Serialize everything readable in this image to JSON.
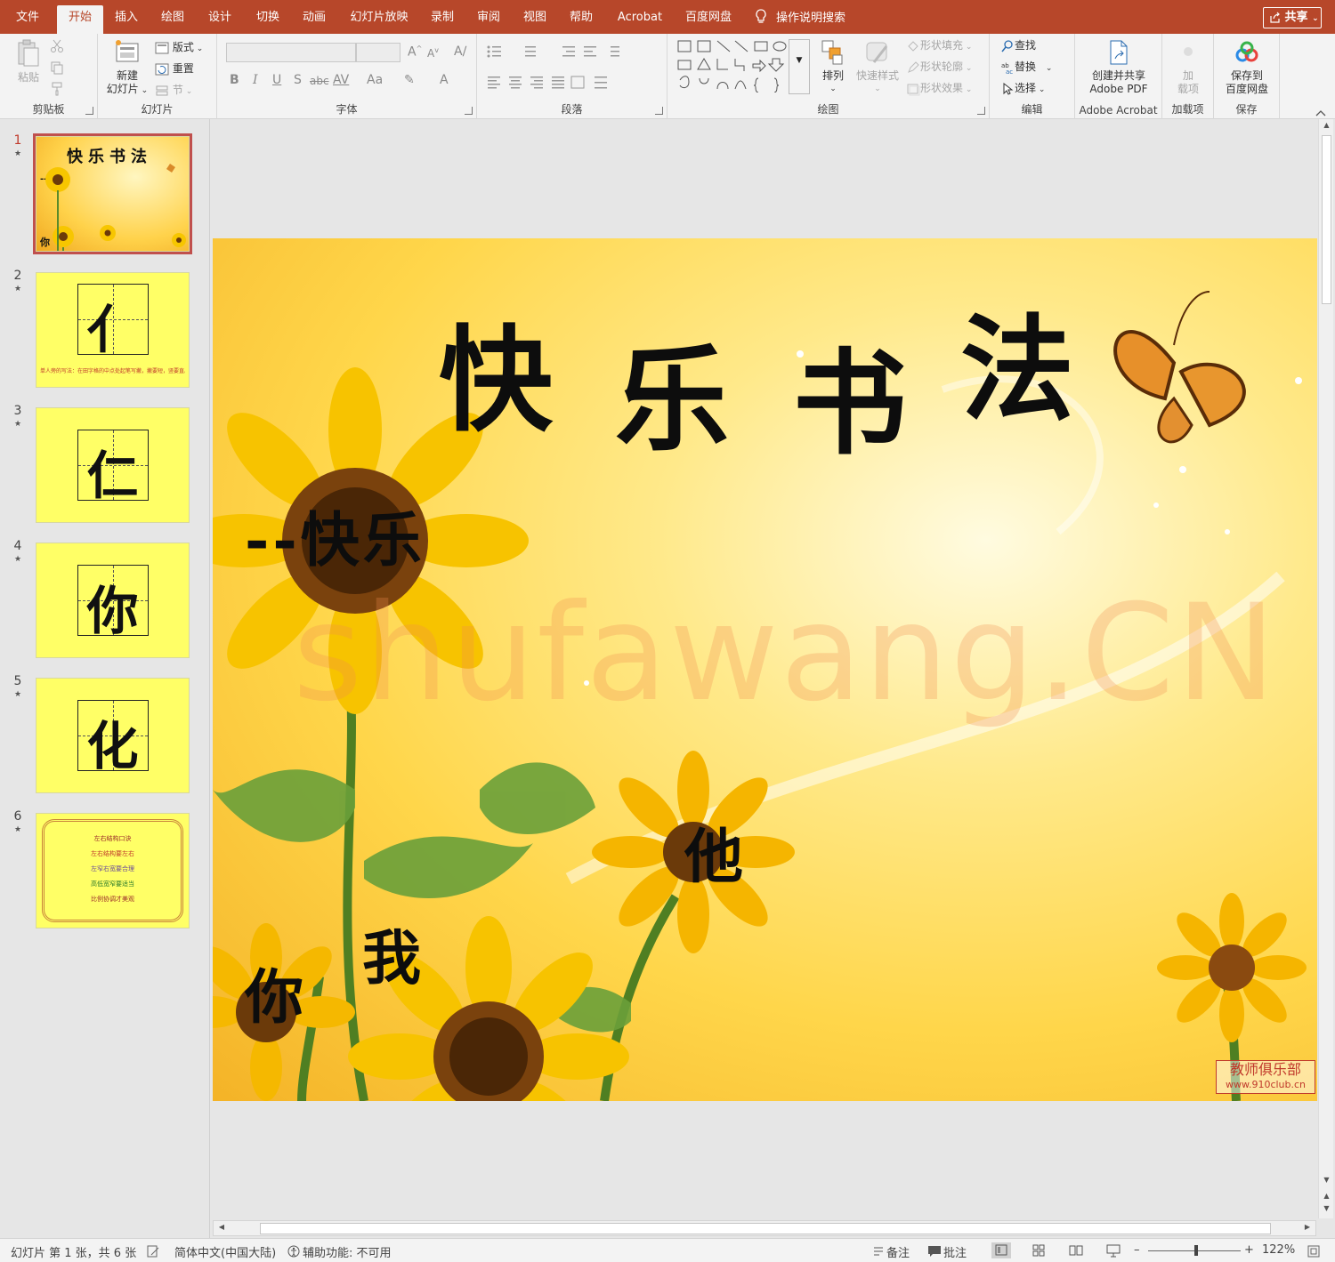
{
  "tabs": [
    {
      "label": "文件",
      "active": false
    },
    {
      "label": "开始",
      "active": true
    },
    {
      "label": "插入",
      "active": false
    },
    {
      "label": "绘图",
      "active": false
    },
    {
      "label": "设计",
      "active": false
    },
    {
      "label": "切换",
      "active": false
    },
    {
      "label": "动画",
      "active": false
    },
    {
      "label": "幻灯片放映",
      "active": false
    },
    {
      "label": "录制",
      "active": false
    },
    {
      "label": "审阅",
      "active": false
    },
    {
      "label": "视图",
      "active": false
    },
    {
      "label": "帮助",
      "active": false
    },
    {
      "label": "Acrobat",
      "active": false
    },
    {
      "label": "百度网盘",
      "active": false
    }
  ],
  "search": {
    "label": "操作说明搜索"
  },
  "share": {
    "label": "共享"
  },
  "ribbon": {
    "clipboard": {
      "label": "剪贴板",
      "paste": "粘贴"
    },
    "slides": {
      "label": "幻灯片",
      "new_slide_line1": "新建",
      "new_slide_line2": "幻灯片",
      "layout": "版式",
      "reset": "重置",
      "section": "节"
    },
    "font": {
      "label": "字体",
      "bold": "B",
      "italic": "I",
      "underline": "U",
      "shadow": "S",
      "strike": "abc",
      "spacing": "AV",
      "case": "Aa"
    },
    "paragraph": {
      "label": "段落"
    },
    "drawing": {
      "label": "绘图",
      "arrange": "排列",
      "quick_styles": "快速样式",
      "shape_fill": "形状填充",
      "shape_outline": "形状轮廓",
      "shape_effects": "形状效果"
    },
    "editing": {
      "label": "编辑",
      "find": "查找",
      "replace": "替换",
      "select": "选择"
    },
    "acrobat": {
      "label": "Adobe Acrobat",
      "create_line1": "创建并共享",
      "create_line2": "Adobe PDF"
    },
    "addins": {
      "label": "加载项",
      "addin_line1": "加",
      "addin_line2": "载项"
    },
    "save": {
      "label": "保存",
      "save_line1": "保存到",
      "save_line2": "百度网盘"
    }
  },
  "thumbnails": [
    {
      "number": "1",
      "active": true,
      "kind": "title"
    },
    {
      "number": "2",
      "active": false,
      "kind": "char",
      "glyph": "亻",
      "note": "单人旁的写法：在田字格的中点处起笔写撇，撇要短，竖要直。"
    },
    {
      "number": "3",
      "active": false,
      "kind": "char",
      "glyph": "仁",
      "note": ""
    },
    {
      "number": "4",
      "active": false,
      "kind": "char",
      "glyph": "你",
      "note": ""
    },
    {
      "number": "5",
      "active": false,
      "kind": "char",
      "glyph": "化",
      "note": ""
    },
    {
      "number": "6",
      "active": false,
      "kind": "poem",
      "lines": [
        "左右结构口诀",
        "左右结构要左右",
        "左窄右宽要合理",
        "高低宽窄要适当",
        "比例协调才美观"
      ]
    }
  ],
  "slide": {
    "title_chars": [
      "快",
      "乐",
      "书",
      "法"
    ],
    "subtitle": "--快乐",
    "words": {
      "ta": "他",
      "wo": "我",
      "ni": "你"
    },
    "watermark": "shufawang.CN",
    "badge_line1": "教师俱乐部",
    "badge_line2": "www.910club.cn"
  },
  "thumb1": {
    "title": "快乐书法",
    "subtitle": "--快乐",
    "word": "你"
  },
  "status": {
    "slide_info": "幻灯片 第 1 张，共 6 张",
    "language": "简体中文(中国大陆)",
    "accessibility": "辅助功能: 不可用",
    "notes": "备注",
    "comments": "批注",
    "zoom": "122%"
  },
  "colors": {
    "accent": "#b7472a",
    "ribbon_bg": "#f3f3f3",
    "slide_thumb_bg": "#ffff66",
    "active_outline": "#c0504d"
  }
}
